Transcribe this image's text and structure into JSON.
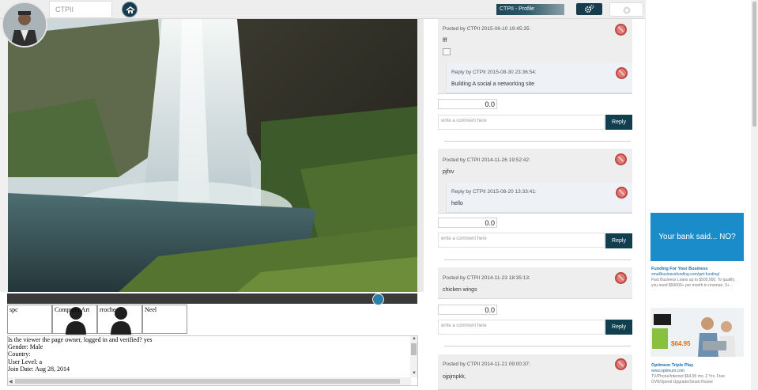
{
  "header": {
    "site_title": "CTPII",
    "profile_label": "CTPII - Profile"
  },
  "icons": {
    "home": "home-icon",
    "gear": "gear-icon",
    "settings": "settings-icon",
    "delete": "delete-icon"
  },
  "colors": {
    "primary": "#123f4f",
    "delete": "#dd7b76",
    "ad_blue": "#1a8cca"
  },
  "friends": [
    {
      "name": "spc"
    },
    {
      "name": "Computer Art"
    },
    {
      "name": "rroche"
    },
    {
      "name": "Neel"
    }
  ],
  "details": {
    "line1": "Is the viewer the page owner, logged in and verified? yes",
    "line2": "Gender: Male",
    "line3": "Country:",
    "line4": "User Level: a",
    "line5": "Join Date: Aug 28, 2014"
  },
  "feed": {
    "posts": [
      {
        "meta": "Posted by CTPII 2015-06-10 19:45:35:",
        "text": "fff",
        "reply_meta": "Reply by CTPII 2015-08-30 23:36:54:",
        "reply_text": "Building A social a networking site",
        "rating": "0.0",
        "comment_placeholder": "write a comment here",
        "reply_button": "Reply"
      },
      {
        "meta": "Posted by CTPII 2014-11-26 19:52:42:",
        "text": "pjfxv",
        "reply_meta": "Reply by CTPII 2015-08-20 13:33:41:",
        "reply_text": "hello",
        "rating": "0.0",
        "comment_placeholder": "write a comment here",
        "reply_button": "Reply"
      },
      {
        "meta": "Posted by CTPII 2014-11-23 18:35:13:",
        "text": "chicken wings",
        "rating": "0.0",
        "comment_placeholder": "write a comment here",
        "reply_button": "Reply"
      },
      {
        "meta": "Posted by CTPII 2014-11-21 09:00:37:",
        "text": "ojpjmpkk,"
      }
    ]
  },
  "ads": {
    "banner_text": "Your bank said... NO?",
    "ad1": {
      "title": "Funding For Your Business",
      "url": "smallbusinessfunding.com/get-funding/",
      "desc": "Fast Business Loans up to $500,000. To qualify, you need $50000+ per month in revenue. 3+..."
    },
    "ad2": {
      "title": "Optimum Triple Play",
      "url": "www.optimum.com",
      "desc": "TV/Phone/Internet $64.95 mo. 2 Yrs. Free DVR/Speed Upgrade/Smart Router",
      "price": "$64.95"
    }
  }
}
